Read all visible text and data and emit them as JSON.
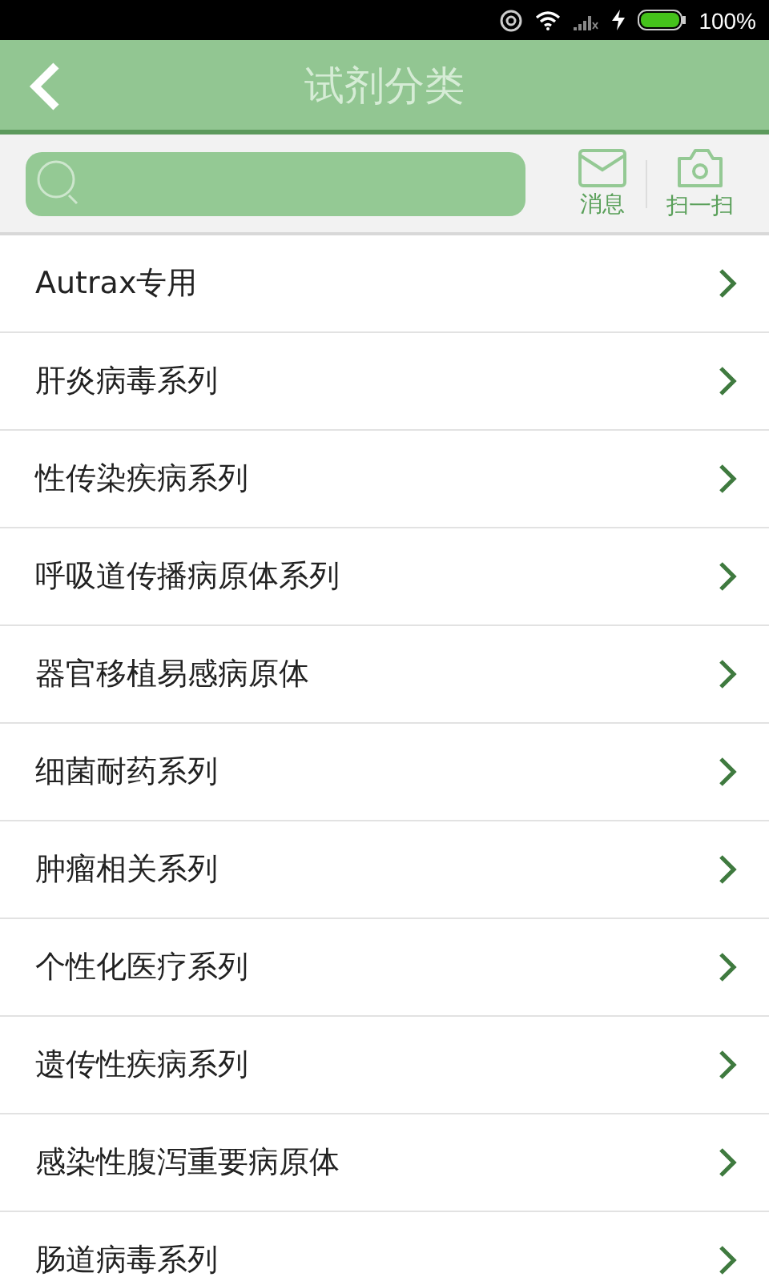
{
  "status_bar": {
    "battery": "100%"
  },
  "header": {
    "title": "试剂分类"
  },
  "toolbar": {
    "actions": [
      {
        "kind": "mail",
        "label": "消息"
      },
      {
        "kind": "camera",
        "label": "扫一扫"
      }
    ]
  },
  "categories": [
    {
      "label": "Autrax专用"
    },
    {
      "label": "肝炎病毒系列"
    },
    {
      "label": "性传染疾病系列"
    },
    {
      "label": "呼吸道传播病原体系列"
    },
    {
      "label": "器官移植易感病原体"
    },
    {
      "label": "细菌耐药系列"
    },
    {
      "label": "肿瘤相关系列"
    },
    {
      "label": "个性化医疗系列"
    },
    {
      "label": "遗传性疾病系列"
    },
    {
      "label": "感染性腹泻重要病原体"
    },
    {
      "label": "肠道病毒系列"
    }
  ]
}
